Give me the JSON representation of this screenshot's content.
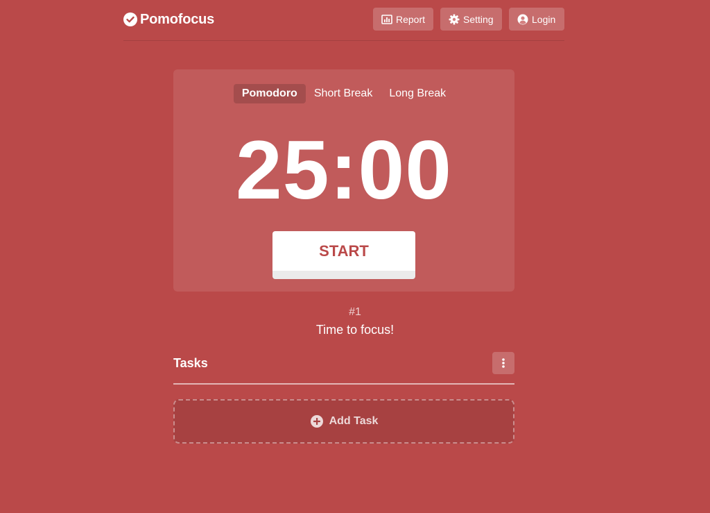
{
  "theme": {
    "background": "#ba4949",
    "accent": "#ffffff"
  },
  "header": {
    "brand": "Pomofocus",
    "brand_icon": "check-circle-icon",
    "nav": {
      "report": {
        "label": "Report",
        "icon": "bar-chart-icon"
      },
      "setting": {
        "label": "Setting",
        "icon": "gear-icon"
      },
      "login": {
        "label": "Login",
        "icon": "user-circle-icon"
      }
    }
  },
  "timer": {
    "modes": [
      {
        "label": "Pomodoro",
        "active": true
      },
      {
        "label": "Short Break",
        "active": false
      },
      {
        "label": "Long Break",
        "active": false
      }
    ],
    "time": "25:00",
    "start_label": "START"
  },
  "session": {
    "number": "#1",
    "message": "Time to focus!"
  },
  "tasks": {
    "title": "Tasks",
    "menu_icon": "vertical-dots-icon",
    "add_label": "Add Task",
    "add_icon": "plus-circle-icon"
  }
}
